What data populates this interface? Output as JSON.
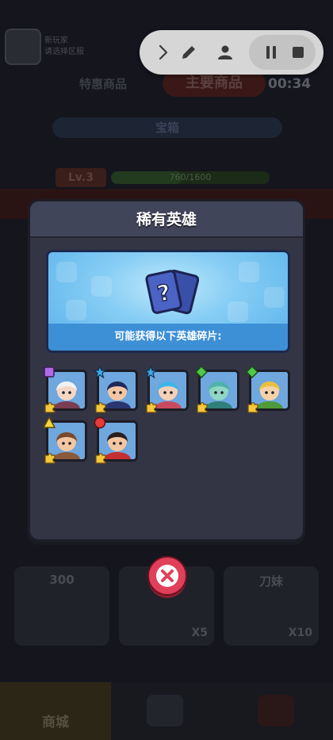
{
  "background": {
    "player_name": "新玩家",
    "player_sub": "请选择区服",
    "left_tab": "特惠商品",
    "main_tab": "主要商品",
    "timer": "00:34",
    "section_title": "宝箱",
    "level": "Lv.3",
    "xp_text": "760/1600",
    "xp_fraction": 0.45,
    "cards": [
      {
        "label": "300",
        "count": ""
      },
      {
        "label": "",
        "count": "X5"
      },
      {
        "label": "刀妹",
        "count": "X10"
      }
    ],
    "nav_shop_label": "商城"
  },
  "toolbar": {
    "icons": [
      "chevron-right-icon",
      "pencil-icon",
      "person-icon",
      "pause-icon",
      "stop-icon"
    ]
  },
  "modal": {
    "title": "稀有英雄",
    "banner_caption": "可能获得以下英雄碎片:",
    "heroes": [
      {
        "name": "white-hair-hero",
        "rarity": "purple-square",
        "colors": {
          "bg": "#6fa7df",
          "hair": "#f2f2f4",
          "skin": "#f4d7c4",
          "cloth": "#7a3d52"
        }
      },
      {
        "name": "wizard-hero",
        "rarity": "blue-star",
        "colors": {
          "bg": "#6fa7df",
          "hair": "#1e2a5a",
          "skin": "#f4c6a2",
          "cloth": "#2a3670"
        }
      },
      {
        "name": "blue-hair-hero",
        "rarity": "blue-star",
        "colors": {
          "bg": "#6fa7df",
          "hair": "#3fb5e8",
          "skin": "#f4d0b8",
          "cloth": "#c94a5d"
        }
      },
      {
        "name": "dragon-hero",
        "rarity": "green-diamond",
        "colors": {
          "bg": "#6fa7df",
          "hair": "#4fb2a8",
          "skin": "#8fd6c4",
          "cloth": "#2f7f7a"
        }
      },
      {
        "name": "leaf-hero",
        "rarity": "green-diamond",
        "colors": {
          "bg": "#6fa7df",
          "hair": "#e8c03e",
          "skin": "#f4d2aa",
          "cloth": "#4f9a3a"
        }
      },
      {
        "name": "cowboy-hero",
        "rarity": "yellow-triangle",
        "colors": {
          "bg": "#6fa7df",
          "hair": "#7a4a2e",
          "skin": "#f4c6a2",
          "cloth": "#8a5a3a"
        }
      },
      {
        "name": "bandana-hero",
        "rarity": "red-circle",
        "colors": {
          "bg": "#6fa7df",
          "hair": "#2a1e1e",
          "skin": "#f4c6a2",
          "cloth": "#c42f2f"
        }
      }
    ]
  },
  "close_button": {
    "icon": "close-icon"
  }
}
